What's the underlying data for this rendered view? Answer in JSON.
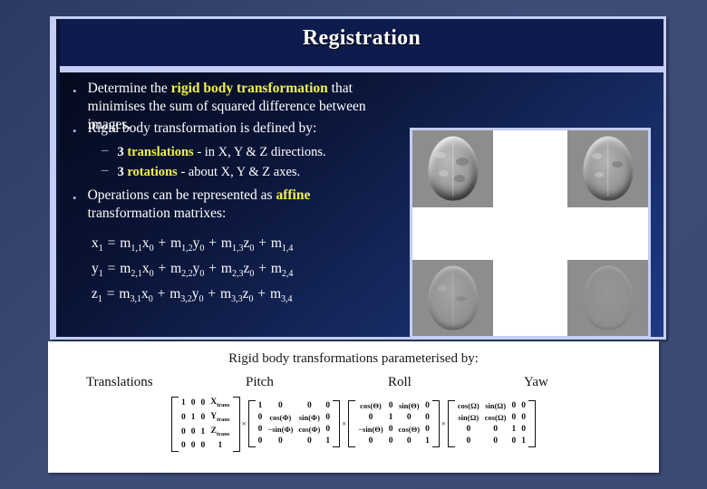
{
  "slide": {
    "title": "Registration",
    "bullets": [
      {
        "marker": "•",
        "segments": [
          {
            "t": "Determine the ",
            "style": "plain"
          },
          {
            "t": "rigid body transformation",
            "style": "highlight"
          },
          {
            "t": " that minimises the sum of squared difference between images.",
            "style": "plain"
          }
        ]
      },
      {
        "marker": "•",
        "segments": [
          {
            "t": "Rigid body transformation is defined by:",
            "style": "plain"
          }
        ]
      }
    ],
    "sub_bullets": [
      {
        "marker": "–",
        "segments": [
          {
            "t": "3 ",
            "style": "white-bold"
          },
          {
            "t": "translations",
            "style": "highlight"
          },
          {
            "t": " - in X, Y & Z directions.",
            "style": "plain"
          }
        ]
      },
      {
        "marker": "–",
        "segments": [
          {
            "t": "3 ",
            "style": "white-bold"
          },
          {
            "t": "rotations",
            "style": "highlight"
          },
          {
            "t": " - about X, Y & Z axes.",
            "style": "plain"
          }
        ]
      }
    ],
    "bullet3": {
      "marker": "•",
      "segments": [
        {
          "t": "Operations can be represented as ",
          "style": "plain"
        },
        {
          "t": "affine",
          "style": "highlight"
        },
        {
          "t": " transformation matrixes:",
          "style": "plain"
        }
      ]
    },
    "equations": [
      {
        "lhs": "x",
        "lhs_sub": "1",
        "terms": [
          {
            "m": "m",
            "sub": "1,1",
            "var": "x",
            "vsub": "0"
          },
          {
            "m": "m",
            "sub": "1,2",
            "var": "y",
            "vsub": "0"
          },
          {
            "m": "m",
            "sub": "1,3",
            "var": "z",
            "vsub": "0"
          },
          {
            "m": "m",
            "sub": "1,4",
            "var": "",
            "vsub": ""
          }
        ]
      },
      {
        "lhs": "y",
        "lhs_sub": "1",
        "terms": [
          {
            "m": "m",
            "sub": "2,1",
            "var": "x",
            "vsub": "0"
          },
          {
            "m": "m",
            "sub": "2,2",
            "var": "y",
            "vsub": "0"
          },
          {
            "m": "m",
            "sub": "2,3",
            "var": "z",
            "vsub": "0"
          },
          {
            "m": "m",
            "sub": "2,4",
            "var": "",
            "vsub": ""
          }
        ]
      },
      {
        "lhs": "z",
        "lhs_sub": "1",
        "terms": [
          {
            "m": "m",
            "sub": "3,1",
            "var": "x",
            "vsub": "0"
          },
          {
            "m": "m",
            "sub": "3,2",
            "var": "y",
            "vsub": "0"
          },
          {
            "m": "m",
            "sub": "3,3",
            "var": "z",
            "vsub": "0"
          },
          {
            "m": "m",
            "sub": "3,4",
            "var": "",
            "vsub": ""
          }
        ]
      }
    ],
    "image_grid": {
      "caption": "",
      "cells": [
        "brain-difference-top-left",
        "brain-difference-top-right",
        "brain-difference-bottom-left",
        "brain-difference-bottom-right"
      ]
    }
  },
  "bottom_panel": {
    "title": "Rigid body transformations parameterised by:",
    "labels": [
      "Translations",
      "Pitch",
      "Roll",
      "Yaw"
    ],
    "multiply_symbol": "×",
    "matrices": [
      {
        "name": "Translations",
        "rows": [
          [
            "1",
            "0",
            "0",
            "X|trans"
          ],
          [
            "0",
            "1",
            "0",
            "Y|trans"
          ],
          [
            "0",
            "0",
            "1",
            "Z|trans"
          ],
          [
            "0",
            "0",
            "0",
            "1"
          ]
        ]
      },
      {
        "name": "Pitch",
        "rows": [
          [
            "1",
            "0",
            "0",
            "0"
          ],
          [
            "0",
            "cos(Φ)",
            "sin(Φ)",
            "0"
          ],
          [
            "0",
            "−sin(Φ)",
            "cos(Φ)",
            "0"
          ],
          [
            "0",
            "0",
            "0",
            "1"
          ]
        ]
      },
      {
        "name": "Roll",
        "rows": [
          [
            "cos(Θ)",
            "0",
            "sin(Θ)",
            "0"
          ],
          [
            "0",
            "1",
            "0",
            "0"
          ],
          [
            "−sin(Θ)",
            "0",
            "cos(Θ)",
            "0"
          ],
          [
            "0",
            "0",
            "0",
            "1"
          ]
        ]
      },
      {
        "name": "Yaw",
        "rows": [
          [
            "cos(Ω)",
            "sin(Ω)",
            "0",
            "0"
          ],
          [
            "sin(Ω)",
            "cos(Ω)",
            "0",
            "0"
          ],
          [
            "0",
            "0",
            "1",
            "0"
          ],
          [
            "0",
            "0",
            "0",
            "1"
          ]
        ]
      }
    ]
  },
  "colors": {
    "background": "#3b4a73",
    "panel_frame": "#c3cdf5",
    "title_bg": "#0d1b4d",
    "highlight": "#f2f24a",
    "text": "#ffffff"
  }
}
